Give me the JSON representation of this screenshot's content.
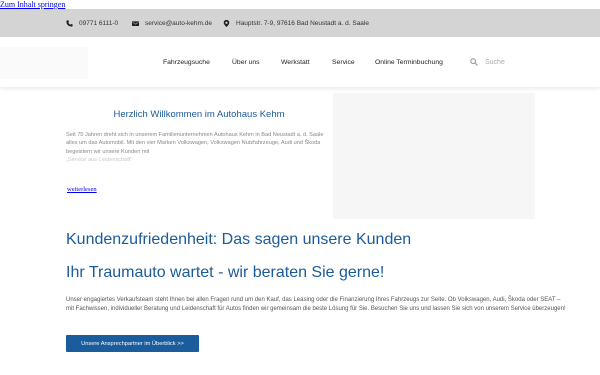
{
  "skip_link": "Zum Inhalt springen",
  "topbar": {
    "phone": "09771 6111-0",
    "email": "service@auto-kehm.de",
    "address": "Hauptstr. 7-9, 97616 Bad Neustadt a. d. Saale",
    "phone_icon": "phone-icon",
    "email_icon": "envelope-icon",
    "address_icon": "map-marker-icon"
  },
  "nav": {
    "items": [
      "Fahrzeugsuche",
      "Über uns",
      "Werkstatt",
      "Service",
      "Online Terminbuchung"
    ],
    "search_placeholder": "Suche",
    "search_icon": "search-icon"
  },
  "welcome": {
    "title": "Herzlich Willkommen im Autohaus Kehm",
    "text": "Seit 75 Jahren dreht sich in unserem Familienunternehmen Autohaus Kehm in Bad Neustadt a. d. Saale alles um das Automobil. Mit den vier Marken Volkswagen, Volkswagen Nutzfahrzeuge, Audi und Škoda begeistern wir unsere Kunden mit",
    "text_fade": "„Service aus Leidenschaft“",
    "read_more": "weiterlesen"
  },
  "section": {
    "heading1": "Kundenzufriedenheit: Das sagen unsere Kunden",
    "heading2": "Ihr Traumauto wartet - wir beraten Sie gerne!",
    "paragraph": "Unser engagiertes Verkaufsteam steht Ihnen bei allen Fragen rund um den Kauf, das Leasing oder die Finanzierung Ihres Fahrzeugs zur Seite. Ob Volkswagen, Audi, Škoda oder SEAT – mit Fachwissen, individueller Beratung und Leidenschaft für Autos finden wir gemeinsam die beste Lösung für Sie. Besuchen Sie uns und lassen Sie sich von unserem Service überzeugen!",
    "cta": "Unsere Ansprechpartner im Überblick >>"
  },
  "colors": {
    "primary": "#1c5b99",
    "topbar_bg": "#d4d4d4"
  }
}
